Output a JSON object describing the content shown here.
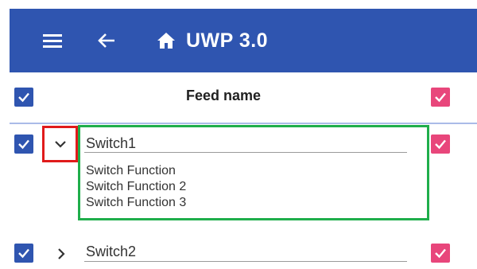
{
  "appbar": {
    "title": "UWP 3.0",
    "menu_icon": "hamburger-menu-icon",
    "back_icon": "arrow-left-icon",
    "home_icon": "home-icon",
    "background": "#2f55b0"
  },
  "header": {
    "column_title": "Feed name"
  },
  "rows": [
    {
      "name": "Switch1",
      "expanded": true,
      "functions": [
        "Switch Function",
        "Switch Function 2",
        "Switch Function 3"
      ]
    },
    {
      "name": "Switch2",
      "expanded": false
    }
  ],
  "colors": {
    "checkbox_blue": "#2f55b0",
    "checkbox_pink": "#e8467b",
    "highlight_red": "#e01b1b",
    "highlight_green": "#1fae4b"
  }
}
